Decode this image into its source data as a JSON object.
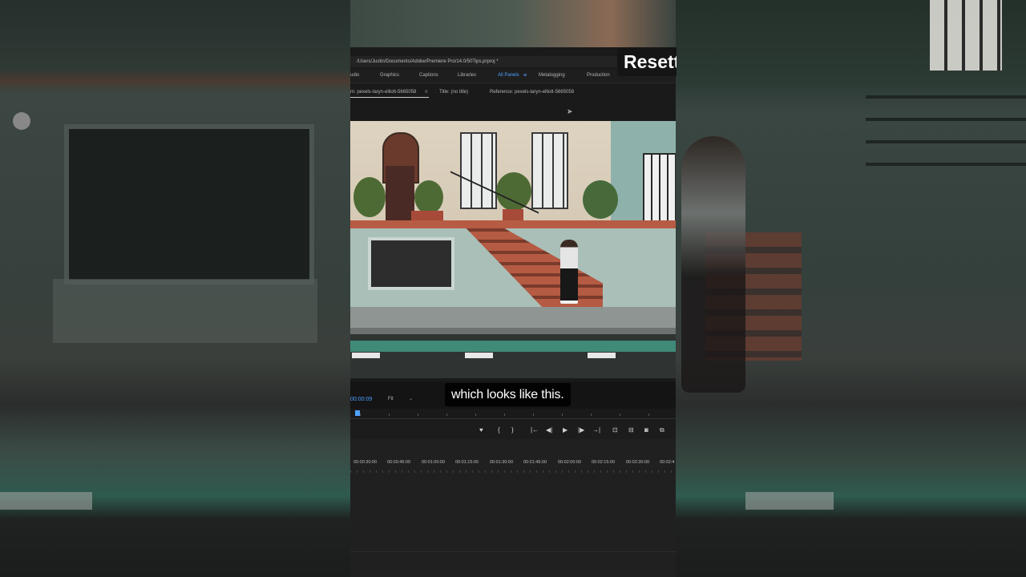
{
  "window": {
    "project_path": "/Users/Justin/Documents/Adobe/Premiere Pro/14.0/50Tips.prproj *"
  },
  "workspaces": {
    "items": [
      {
        "label": "udio"
      },
      {
        "label": "Graphics"
      },
      {
        "label": "Captions"
      },
      {
        "label": "Libraries"
      },
      {
        "label": "All Panels",
        "active": true
      },
      {
        "label": "Metalogging"
      },
      {
        "label": "Production"
      }
    ],
    "menu_icon": "hamburger-icon"
  },
  "monitor": {
    "source_tab": "m: pexels-taryn-elliott-5665058",
    "source_menu_icon": "hamburger-icon",
    "title_label": "Title: (no title)",
    "reference_label": "Reference: pexels-taryn-elliott-5665058",
    "timecode": "00:00:09",
    "zoom": "Fit"
  },
  "caption": {
    "text": "which looks like this."
  },
  "overlay_title": {
    "text": "Resett"
  },
  "transport": {
    "buttons": [
      {
        "name": "add-marker-button",
        "icon": "marker-icon",
        "glyph": "♥"
      },
      {
        "name": "mark-in-button",
        "icon": "mark-in-icon",
        "glyph": "{"
      },
      {
        "name": "mark-out-button",
        "icon": "mark-out-icon",
        "glyph": "}"
      },
      {
        "name": "go-to-in-button",
        "icon": "go-to-in-icon",
        "glyph": "|←"
      },
      {
        "name": "step-back-button",
        "icon": "step-back-icon",
        "glyph": "◀|"
      },
      {
        "name": "play-button",
        "icon": "play-icon",
        "glyph": "▶"
      },
      {
        "name": "step-forward-button",
        "icon": "step-forward-icon",
        "glyph": "|▶"
      },
      {
        "name": "go-to-out-button",
        "icon": "go-to-out-icon",
        "glyph": "→|"
      },
      {
        "name": "insert-button",
        "icon": "insert-icon",
        "glyph": "⊡"
      },
      {
        "name": "overwrite-button",
        "icon": "overwrite-icon",
        "glyph": "⊟"
      },
      {
        "name": "export-frame-button",
        "icon": "camera-icon",
        "glyph": "◙"
      },
      {
        "name": "button-editor-button",
        "icon": "button-editor-icon",
        "glyph": "⧉"
      }
    ]
  },
  "ruler": {
    "labels": [
      "00:00:30:00",
      "00:00:45:00",
      "00:01:00:00",
      "00:01:15:00",
      "00:01:30:00",
      "00:01:45:00",
      "00:02:00:00",
      "00:02:15:00",
      "00:02:30:00",
      "00:02:4"
    ]
  },
  "colors": {
    "accent": "#4ea1ff",
    "panel": "#1e1e1e"
  }
}
